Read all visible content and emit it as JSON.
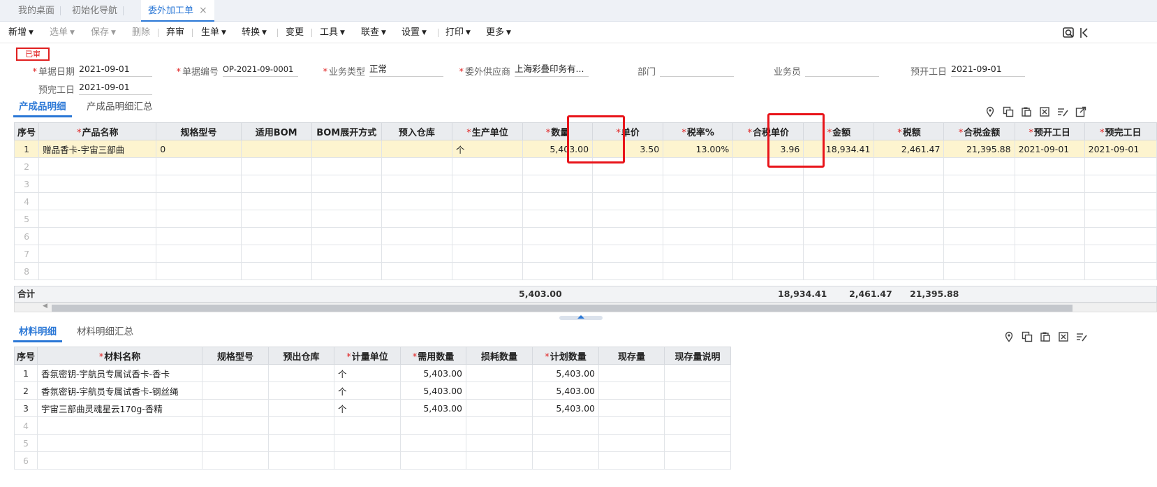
{
  "tabs": [
    {
      "label": "我的桌面"
    },
    {
      "label": "初始化导航"
    },
    {
      "label": "委外加工单",
      "close": "×"
    }
  ],
  "toolbar": {
    "items": [
      "新增",
      "选单",
      "保存",
      "删除",
      "弃审",
      "生单",
      "转换",
      "变更",
      "工具",
      "联查",
      "设置",
      "打印",
      "更多"
    ]
  },
  "status": {
    "stamp": "已审"
  },
  "form": {
    "doc_date": {
      "label": "单据日期",
      "value": "2021-09-01"
    },
    "doc_no": {
      "label": "单据编号",
      "value": "OP-2021-09-0001"
    },
    "biz_type": {
      "label": "业务类型",
      "value": "正常"
    },
    "supplier": {
      "label": "委外供应商",
      "value": "上海彩叠印务有..."
    },
    "dept": {
      "label": "部门",
      "value": ""
    },
    "salesman": {
      "label": "业务员",
      "value": ""
    },
    "plan_start": {
      "label": "预开工日",
      "value": "2021-09-01"
    },
    "plan_finish": {
      "label": "预完工日",
      "value": "2021-09-01"
    }
  },
  "product_section": {
    "tabs": [
      "产成品明细",
      "产成品明细汇总"
    ],
    "columns": [
      "序号",
      "产品名称",
      "规格型号",
      "适用BOM",
      "BOM展开方式",
      "预入仓库",
      "生产单位",
      "数量",
      "单价",
      "税率%",
      "合税单价",
      "金额",
      "税额",
      "合税金额",
      "预开工日",
      "预完工日"
    ],
    "rows": [
      [
        "1",
        "赠品香卡-宇宙三部曲",
        "0",
        "",
        "",
        "",
        "个",
        "5,403.00",
        "3.50",
        "13.00%",
        "3.96",
        "18,934.41",
        "2,461.47",
        "21,395.88",
        "2021-09-01",
        "2021-09-01"
      ],
      [
        "2",
        "",
        "",
        "",
        "",
        "",
        "",
        "",
        "",
        "",
        "",
        "",
        "",
        "",
        "",
        ""
      ],
      [
        "3",
        "",
        "",
        "",
        "",
        "",
        "",
        "",
        "",
        "",
        "",
        "",
        "",
        "",
        "",
        ""
      ],
      [
        "4",
        "",
        "",
        "",
        "",
        "",
        "",
        "",
        "",
        "",
        "",
        "",
        "",
        "",
        "",
        ""
      ],
      [
        "5",
        "",
        "",
        "",
        "",
        "",
        "",
        "",
        "",
        "",
        "",
        "",
        "",
        "",
        "",
        ""
      ],
      [
        "6",
        "",
        "",
        "",
        "",
        "",
        "",
        "",
        "",
        "",
        "",
        "",
        "",
        "",
        "",
        ""
      ],
      [
        "7",
        "",
        "",
        "",
        "",
        "",
        "",
        "",
        "",
        "",
        "",
        "",
        "",
        "",
        "",
        ""
      ],
      [
        "8",
        "",
        "",
        "",
        "",
        "",
        "",
        "",
        "",
        "",
        "",
        "",
        "",
        "",
        "",
        ""
      ]
    ],
    "summary": {
      "label": "合计",
      "qty": "5,403.00",
      "amount": "18,934.41",
      "tax": "2,461.47",
      "total": "21,395.88"
    }
  },
  "material_section": {
    "tabs": [
      "材料明细",
      "材料明细汇总"
    ],
    "columns": [
      "序号",
      "材料名称",
      "规格型号",
      "预出仓库",
      "计量单位",
      "需用数量",
      "损耗数量",
      "计划数量",
      "现存量",
      "现存量说明"
    ],
    "rows": [
      [
        "1",
        "香氛密钥-宇航员专属试香卡-香卡",
        "",
        "",
        "个",
        "5,403.00",
        "",
        "5,403.00",
        "",
        ""
      ],
      [
        "2",
        "香氛密钥-宇航员专属试香卡-钢丝绳",
        "",
        "",
        "个",
        "5,403.00",
        "",
        "5,403.00",
        "",
        ""
      ],
      [
        "3",
        "宇宙三部曲灵魂星云170g-香精",
        "",
        "",
        "个",
        "5,403.00",
        "",
        "5,403.00",
        "",
        ""
      ],
      [
        "4",
        "",
        "",
        "",
        "",
        "",
        "",
        "",
        "",
        ""
      ],
      [
        "5",
        "",
        "",
        "",
        "",
        "",
        "",
        "",
        "",
        ""
      ],
      [
        "6",
        "",
        "",
        "",
        "",
        "",
        "",
        "",
        "",
        ""
      ]
    ]
  },
  "colors": {
    "accent": "#2a77d6",
    "highlight": "#e8141a",
    "selected_row": "#fdf4cf"
  }
}
